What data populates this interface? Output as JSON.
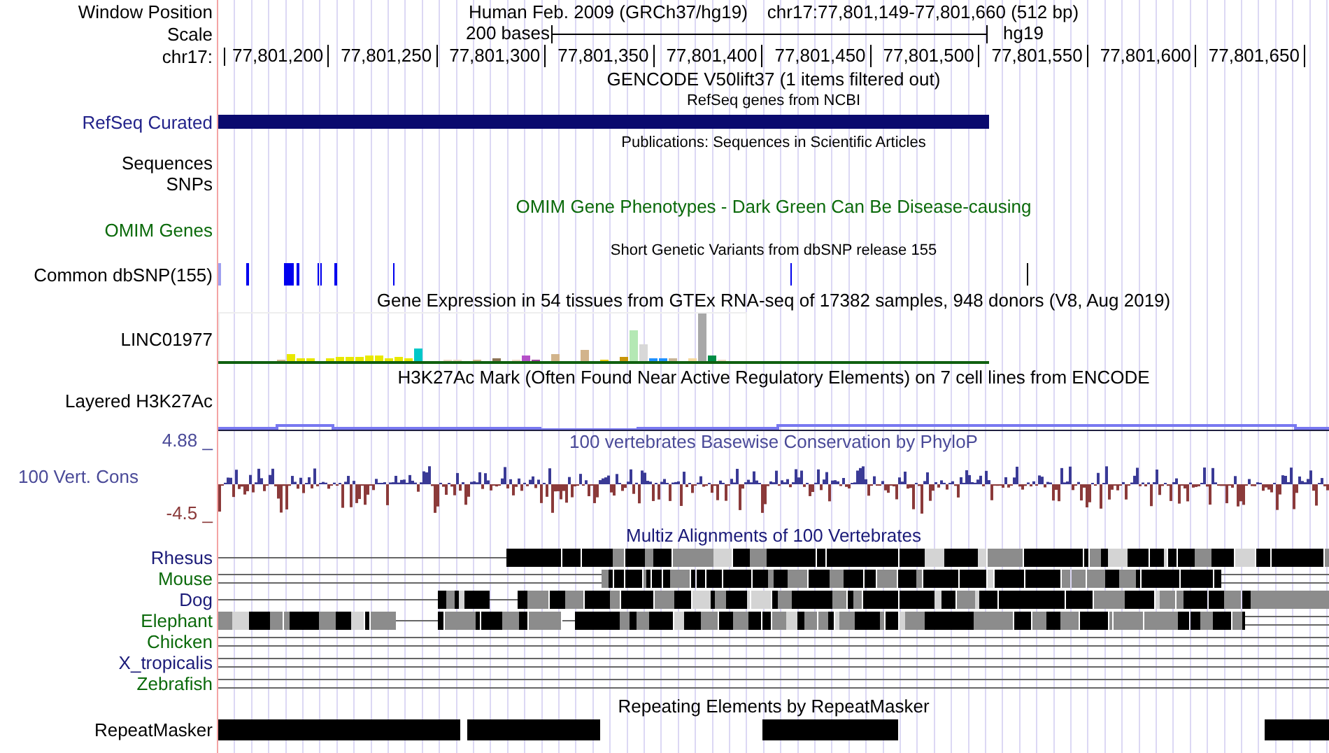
{
  "header": {
    "position_label": "Window Position",
    "assembly": "Human Feb. 2009 (GRCh37/hg19)",
    "position": "chr17:77,801,149-77,801,660 (512 bp)",
    "scale_label": "Scale",
    "scale_length": "200 bases",
    "scale_assembly": "hg19",
    "ruler_label": "chr17:",
    "ruler_ticks": [
      "77,801,200",
      "77,801,250",
      "77,801,300",
      "77,801,350",
      "77,801,400",
      "77,801,450",
      "77,801,500",
      "77,801,550",
      "77,801,600",
      "77,801,650"
    ]
  },
  "tracks": [
    {
      "kind": "title",
      "text": "GENCODE V50lift37 (1 items filtered out)"
    },
    {
      "kind": "subtitle",
      "text": "RefSeq genes from NCBI"
    },
    {
      "kind": "gene",
      "label": "RefSeq Curated",
      "color": "#22228a"
    },
    {
      "kind": "subtitle",
      "text": "Publications: Sequences in Scientific Articles"
    },
    {
      "kind": "label",
      "label": "Sequences",
      "color": "#000000"
    },
    {
      "kind": "label",
      "label": "SNPs",
      "color": "#000000"
    },
    {
      "kind": "title",
      "text": "OMIM Gene Phenotypes - Dark Green Can Be Disease-causing",
      "color": "#0b6a0b"
    },
    {
      "kind": "label",
      "label": "OMIM Genes",
      "color": "#0b6a0b"
    },
    {
      "kind": "subtitle",
      "text": "Short Genetic Variants from dbSNP release 155"
    },
    {
      "kind": "snps",
      "label": "Common dbSNP(155)",
      "color": "#000000"
    },
    {
      "kind": "title",
      "text": "Gene Expression in 54 tissues from GTEx RNA-seq of 17382 samples, 948 donors (V8, Aug 2019)"
    },
    {
      "kind": "expression",
      "label": "LINC01977",
      "color": "#000000"
    },
    {
      "kind": "title",
      "text": "H3K27Ac Mark (Often Found Near Active Regulatory Elements) on 7 cell lines from ENCODE"
    },
    {
      "kind": "layered",
      "label": "Layered H3K27Ac",
      "color": "#000000"
    },
    {
      "kind": "conservation",
      "label": "100 Vert. Cons",
      "title": "100 vertebrates Basewise Conservation by PhyloP",
      "max": "4.88 _",
      "min": "-4.5 _",
      "color": "#4a4a98"
    },
    {
      "kind": "title",
      "text": "Multiz Alignments of 100 Vertebrates",
      "color": "#1a1a78"
    },
    {
      "kind": "alignment",
      "label": "Rhesus",
      "color": "#1a1a78"
    },
    {
      "kind": "alignment",
      "label": "Mouse",
      "color": "#0b6a0b"
    },
    {
      "kind": "alignment",
      "label": "Dog",
      "color": "#1a1a78"
    },
    {
      "kind": "alignment",
      "label": "Elephant",
      "color": "#0b6a0b"
    },
    {
      "kind": "alignment",
      "label": "Chicken",
      "color": "#0b6a0b"
    },
    {
      "kind": "alignment",
      "label": "X_tropicalis",
      "color": "#1a1a78"
    },
    {
      "kind": "alignment",
      "label": "Zebrafish",
      "color": "#0b6a0b"
    },
    {
      "kind": "title",
      "text": "Repeating Elements by RepeatMasker"
    },
    {
      "kind": "repeats",
      "label": "RepeatMasker",
      "color": "#000000"
    }
  ]
}
